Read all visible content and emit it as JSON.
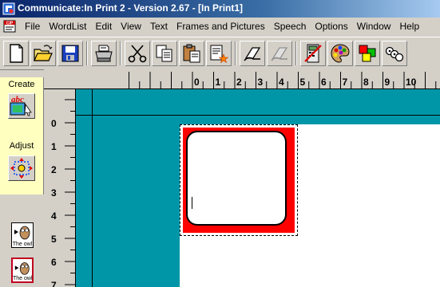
{
  "window": {
    "title": "Communicate:In Print  2 - Version 2.67 - [In Print1]",
    "icon": "app-icon",
    "doc_icon": "doc-menu-icon"
  },
  "menu": {
    "items": [
      "File",
      "WordList",
      "Edit",
      "View",
      "Text",
      "Frames and Pictures",
      "Speech",
      "Options",
      "Window",
      "Help"
    ]
  },
  "toolbar": {
    "buttons": [
      "new-document",
      "open-folder",
      "save",
      "print",
      "cut",
      "copy",
      "paste",
      "paste-special",
      "undo",
      "redo",
      "calculator",
      "palette",
      "colors",
      "symbols"
    ]
  },
  "left_panel": {
    "create_label": "Create",
    "create_icon_text": "abc",
    "adjust_label": "Adjust",
    "wordlist": [
      {
        "label": "The owl",
        "selected": false
      },
      {
        "label": "The owl",
        "selected": true
      }
    ]
  },
  "rulers": {
    "horizontal": [
      "0",
      "1",
      "2",
      "3",
      "4",
      "5",
      "6",
      "7",
      "8",
      "9",
      "10"
    ],
    "vertical": [
      "0",
      "1",
      "2",
      "3",
      "4",
      "5",
      "6",
      "7"
    ]
  },
  "colors": {
    "canvas": "#0096a8",
    "frame_fill": "#ff0000",
    "create_panel": "#ffffc0"
  }
}
